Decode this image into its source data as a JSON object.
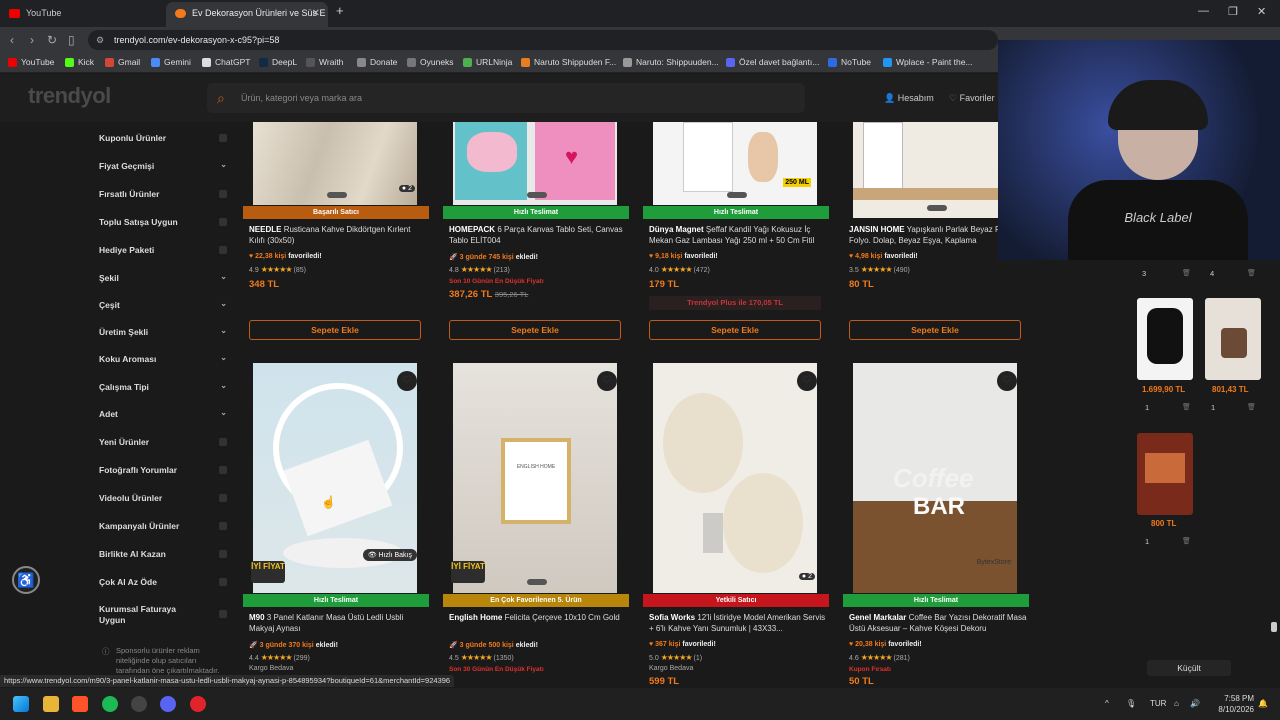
{
  "browser": {
    "tabs": [
      {
        "label": "YouTube"
      },
      {
        "label": "Ev Dekorasyon Ürünleri ve Süs E"
      }
    ],
    "url": "trendyol.com/ev-dekorasyon-x-c95?pi=58",
    "bookmarks": [
      "YouTube",
      "Kick",
      "Gmail",
      "Gemini",
      "ChatGPT",
      "DeepL",
      "Wraith",
      "Donate",
      "Oyuneks",
      "URLNinja",
      "Naruto Shippuden F...",
      "Naruto: Shippuuden...",
      "Özel davet bağlantı...",
      "NoTube",
      "Wplace - Paint the..."
    ],
    "status_url": "https://www.trendyol.com/m90/3-panel-katlanir-masa-ustu-ledli-usbli-makyaj-aynasi-p-854895934?boutiqueId=61&merchantId=924396"
  },
  "header": {
    "logo": "trendyol",
    "search_placeholder": "Ürün, kategori veya marka ara",
    "account": "Hesabım",
    "favorites": "Favoriler"
  },
  "sidebar": {
    "filters": [
      {
        "label": "Kuponlu Ürünler",
        "kind": "check"
      },
      {
        "label": "Fiyat Geçmişi",
        "kind": "expand"
      },
      {
        "label": "Fırsatlı Ürünler",
        "kind": "check"
      },
      {
        "label": "Toplu Satışa Uygun",
        "kind": "check"
      },
      {
        "label": "Hediye Paketi",
        "kind": "check"
      },
      {
        "label": "Şekil",
        "kind": "expand"
      },
      {
        "label": "Çeşit",
        "kind": "expand"
      },
      {
        "label": "Üretim Şekli",
        "kind": "expand"
      },
      {
        "label": "Koku Aroması",
        "kind": "expand"
      },
      {
        "label": "Çalışma Tipi",
        "kind": "expand"
      },
      {
        "label": "Adet",
        "kind": "expand"
      },
      {
        "label": "Yeni Ürünler",
        "kind": "check"
      },
      {
        "label": "Fotoğraflı Yorumlar",
        "kind": "check"
      },
      {
        "label": "Videolu Ürünler",
        "kind": "check"
      },
      {
        "label": "Kampanyalı Ürünler",
        "kind": "check"
      },
      {
        "label": "Birlikte Al Kazan",
        "kind": "check"
      },
      {
        "label": "Çok Al Az Öde",
        "kind": "check"
      },
      {
        "label": "Kurumsal Faturaya Uygun",
        "kind": "check"
      }
    ],
    "sponsor_note": "Sponsorlu ürünler reklam niteliğinde olup satıcıları tarafından öne çıkartılmaktadır."
  },
  "products_row1": [
    {
      "badge": "Başarılı Satıcı",
      "badge_color": "#b85c10",
      "brand": "NEEDLE",
      "title": "Rusticana Kahve Dikdörtgen Kırlent Kılıfı (30x50)",
      "fav_count": "22,38 kişi",
      "fav_text": "favoriledi!",
      "rating": "4.9",
      "reviews": "(85)",
      "price": "348 TL",
      "cart": "Sepete Ekle"
    },
    {
      "badge": "Hızlı Teslimat",
      "badge_color": "#1f9d3a",
      "brand": "HOMEPACK",
      "title": "6 Parça Kanvas Tablo Seti, Canvas Tablo ELİT004",
      "fav_count": "3 günde 745 kişi",
      "fav_text": "ekledi!",
      "rating": "4.8",
      "reviews": "(213)",
      "note": "Son 10 Günün En Düşük Fiyatı",
      "price": "387,26 TL",
      "old_price": "395,26 TL",
      "cart": "Sepete Ekle"
    },
    {
      "badge": "Hızlı Teslimat",
      "badge_color": "#1f9d3a",
      "brand": "Dünya Magnet",
      "title": "Şeffaf Kandil Yağı Kokusuz İç Mekan Gaz Lambası Yağı 250 ml + 50 Cm Fitil",
      "fav_count": "9,18 kişi",
      "fav_text": "favoriledi!",
      "rating": "4.0",
      "reviews": "(472)",
      "price": "179 TL",
      "plus": "Trendyol Plus ile 170,05 TL",
      "cart": "Sepete Ekle",
      "img_tag": "250 ML"
    },
    {
      "badge": "",
      "badge_color": "",
      "brand": "JANSIN HOME",
      "title": "Yapışkanlı Parlak Beyaz Pvc Folyo. Dolap, Beyaz Eşya, Kaplama",
      "fav_count": "4,98 kişi",
      "fav_text": "favoriledi!",
      "rating": "3.5",
      "reviews": "(490)",
      "price": "80 TL",
      "cart": "Sepete Ekle"
    }
  ],
  "products_row2": [
    {
      "badge": "Hızlı Teslimat",
      "badge_color": "#1f9d3a",
      "brand": "M90",
      "title": "3 Panel Katlanır Masa Üstü Ledli Usbli Makyaj Aynası",
      "fav_count": "3 günde 370 kişi",
      "fav_text": "ekledi!",
      "rating": "4.4",
      "reviews": "(299)",
      "extra": "Kargo Bedava",
      "quick_view": "Hızlı Bakış",
      "iyi": "İYİ FİYAT"
    },
    {
      "badge": "En Çok Favorilenen 5. Ürün",
      "badge_color": "#b7860b",
      "brand": "English Home",
      "title": "Felicita Çerçeve 10x10 Cm Gold",
      "fav_count": "3 günde 500 kişi",
      "fav_text": "ekledi!",
      "rating": "4.5",
      "reviews": "(1350)",
      "extra": "Son 30 Günün En Düşük Fiyatı",
      "iyi": "İYİ FİYAT",
      "frame_text": "ENGLISH HOME"
    },
    {
      "badge": "Yetkili Satıcı",
      "badge_color": "#c4161c",
      "brand": "Sofia Works",
      "title": "12'li İstiridye Model Amerikan Servis + 6'lı Kahve Yanı Sunumluk | 43X33...",
      "fav_count": "367 kişi",
      "fav_text": "favoriledi!",
      "rating": "5.0",
      "reviews": "(1)",
      "extra": "Kargo Bedava",
      "price": "599 TL"
    },
    {
      "badge": "Hızlı Teslimat",
      "badge_color": "#1f9d3a",
      "brand": "Genel Markalar",
      "title": "Coffee Bar Yazısı Dekoratif Masa Üstü Aksesuar – Kahve Köşesi Dekoru",
      "fav_count": "20,38 kişi",
      "fav_text": "favoriledi!",
      "rating": "4.6",
      "reviews": "(281)",
      "extra": "Kupon Fırsatı",
      "price": "50 TL",
      "store": "BytexStore",
      "sign1": "Coffee",
      "sign2": "BAR"
    }
  ],
  "cart_panel": {
    "items": [
      {
        "qty": "3",
        "price": ""
      },
      {
        "qty": "4",
        "price": ""
      },
      {
        "qty": "1",
        "price": "1.699,90 TL"
      },
      {
        "qty": "1",
        "price": "801,43 TL"
      },
      {
        "qty": "1",
        "price": "800 TL"
      }
    ],
    "collapse": "Küçült"
  },
  "taskbar": {
    "lang": "TUR",
    "time": "7:58 PM",
    "date": "8/10/2026"
  },
  "webcam_shirt": "Black Label",
  "colors": {
    "accent": "#f27a1a",
    "green": "#1f9d3a"
  }
}
